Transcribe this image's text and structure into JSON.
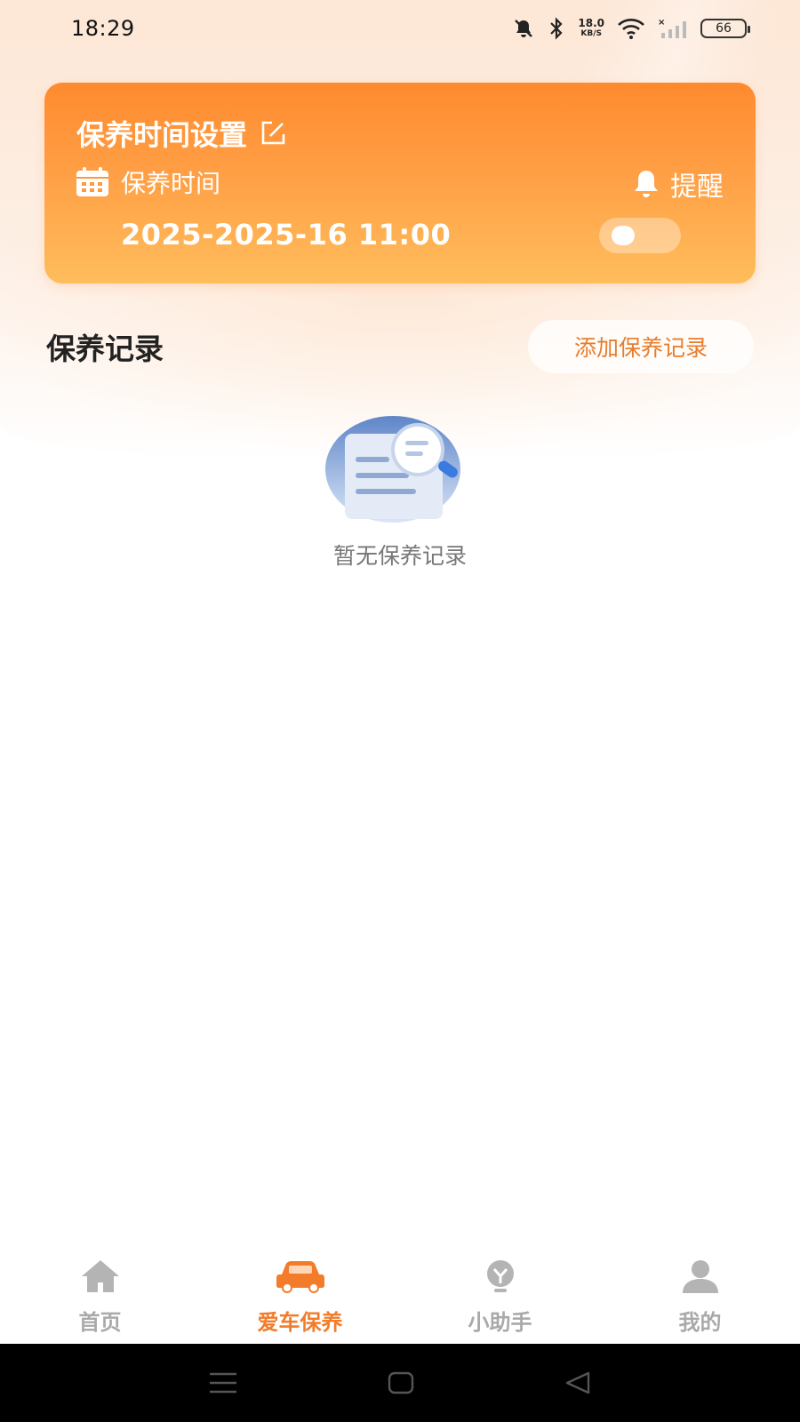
{
  "status_bar": {
    "time": "18:29",
    "net_speed_value": "18.0",
    "net_speed_unit": "KB/S",
    "battery": "66"
  },
  "card": {
    "title": "保养时间设置",
    "time_label": "保养时间",
    "reminder_label": "提醒",
    "time_value": "2025-2025-16 11:00",
    "reminder_enabled": false
  },
  "records": {
    "title": "保养记录",
    "add_button": "添加保养记录",
    "empty_text": "暂无保养记录"
  },
  "tabs": [
    {
      "label": "首页",
      "icon": "home-icon",
      "active": false
    },
    {
      "label": "爱车保养",
      "icon": "car-icon",
      "active": true
    },
    {
      "label": "小助手",
      "icon": "lightbulb-icon",
      "active": false
    },
    {
      "label": "我的",
      "icon": "user-icon",
      "active": false
    }
  ],
  "colors": {
    "accent": "#f27c2a",
    "card_top": "#ff8a2e",
    "card_bottom": "#ffbd5c",
    "inactive_tab": "#a9a9a9"
  }
}
